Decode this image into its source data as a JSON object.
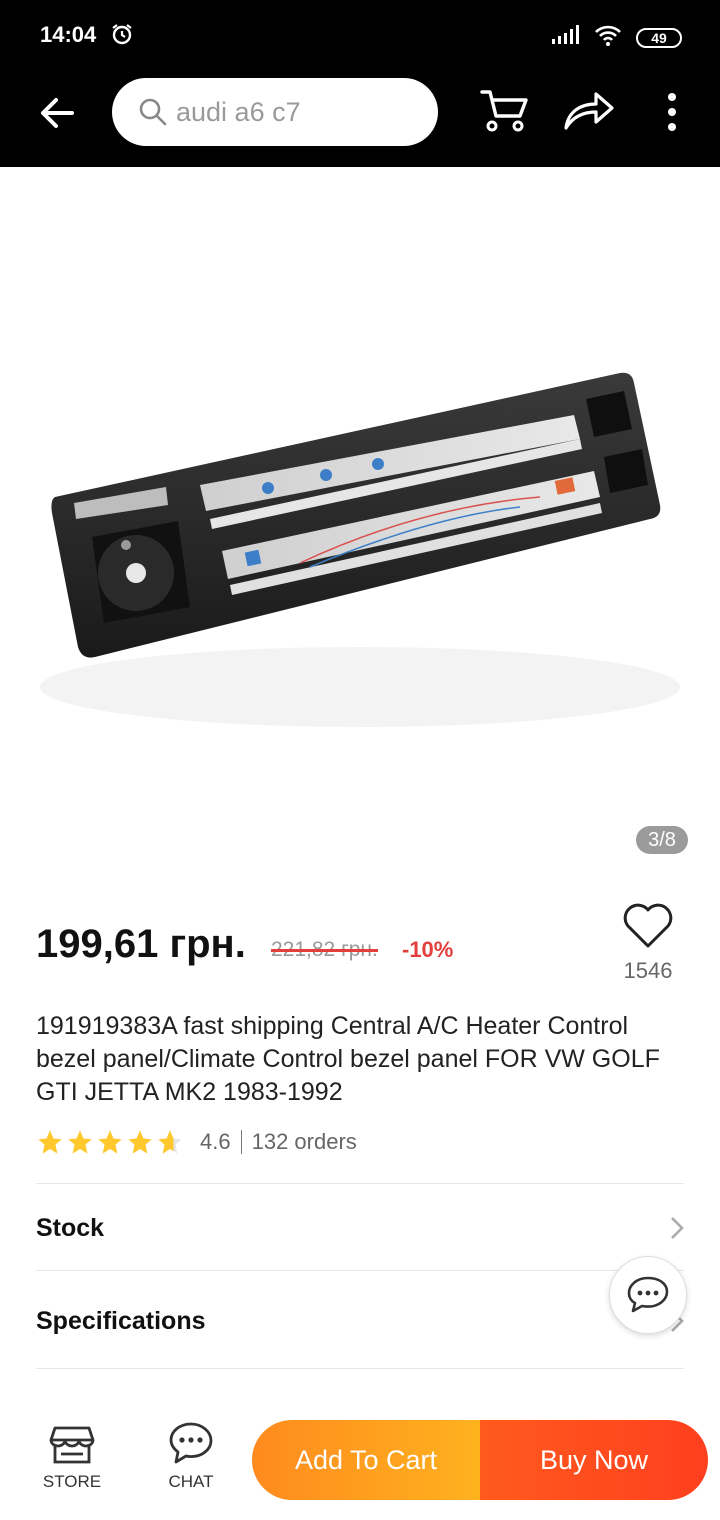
{
  "status_bar": {
    "time": "14:04",
    "battery": "49"
  },
  "header": {
    "search_text": "audi a6 c7"
  },
  "gallery": {
    "counter": "3/8"
  },
  "product": {
    "price": "199,61 грн.",
    "old_price": "221,82 грн.",
    "discount": "-10%",
    "wishlist_count": "1546",
    "title": "191919383A fast shipping Central A/C Heater Control bezel panel/Climate Control bezel panel FOR VW GOLF GTI JETTA MK2 1983-1992",
    "rating": "4.6",
    "rating_stars": 4.6,
    "orders": "132 orders"
  },
  "sections": {
    "stock": "Stock",
    "specifications": "Specifications"
  },
  "bottom_bar": {
    "store_label": "STORE",
    "chat_label": "CHAT",
    "add_to_cart": "Add To Cart",
    "buy_now": "Buy Now"
  },
  "colors": {
    "accent_orange": "#ff8a1e",
    "accent_red": "#ff3f1e",
    "discount_red": "#e3403d",
    "star": "#ffc82c"
  }
}
